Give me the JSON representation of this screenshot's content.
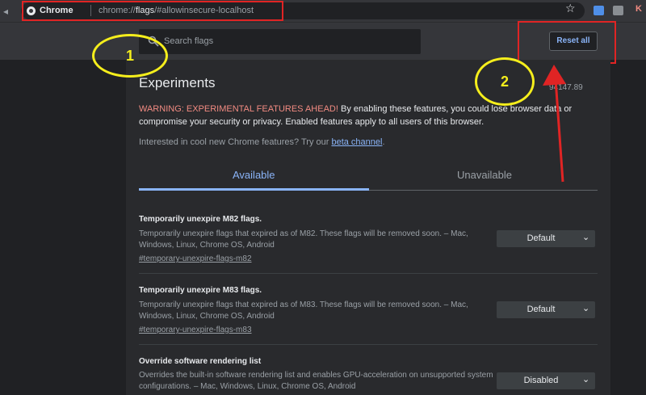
{
  "browser": {
    "site_name": "Chrome",
    "url_prefix": "chrome://",
    "url_host": "flags",
    "url_path": "/#allowinsecure-localhost",
    "icons": [
      "chrome-site-icon",
      "bookmark-star-icon",
      "extension-icon",
      "extension-icon",
      "profile-icon"
    ],
    "ext3_label": "K"
  },
  "header": {
    "search_placeholder": "Search flags",
    "reset_label": "Reset all"
  },
  "main": {
    "title": "Experiments",
    "version": "94147.89",
    "warning_prefix": "WARNING: EXPERIMENTAL FEATURES AHEAD!",
    "warning_text": " By enabling these features, you could lose browser data or compromise your security or privacy. Enabled features apply to all users of this browser.",
    "interest_text": "Interested in cool new Chrome features? Try our ",
    "interest_link": "beta channel",
    "interest_end": ".",
    "tabs": [
      {
        "label": "Available",
        "active": true
      },
      {
        "label": "Unavailable",
        "active": false
      }
    ],
    "flags": [
      {
        "title": "Temporarily unexpire M82 flags.",
        "description": "Temporarily unexpire flags that expired as of M82. These flags will be removed soon. – Mac, Windows, Linux, Chrome OS, Android",
        "link": "#temporary-unexpire-flags-m82",
        "value": "Default"
      },
      {
        "title": "Temporarily unexpire M83 flags.",
        "description": "Temporarily unexpire flags that expired as of M83. These flags will be removed soon. – Mac, Windows, Linux, Chrome OS, Android",
        "link": "#temporary-unexpire-flags-m83",
        "value": "Default"
      },
      {
        "title": "Override software rendering list",
        "description": "Overrides the built-in software rendering list and enables GPU-acceleration on unsupported system configurations. – Mac, Windows, Linux, Chrome OS, Android",
        "link": "",
        "value": "Disabled"
      }
    ]
  },
  "annotations": {
    "label_1": "1",
    "label_2": "2",
    "highlight_color": "#e02424",
    "circle_color": "#f5ee1c"
  },
  "colors": {
    "accent": "#8ab4f8",
    "warning": "#f28b82",
    "background": "#202124",
    "panel": "#292a2d"
  }
}
